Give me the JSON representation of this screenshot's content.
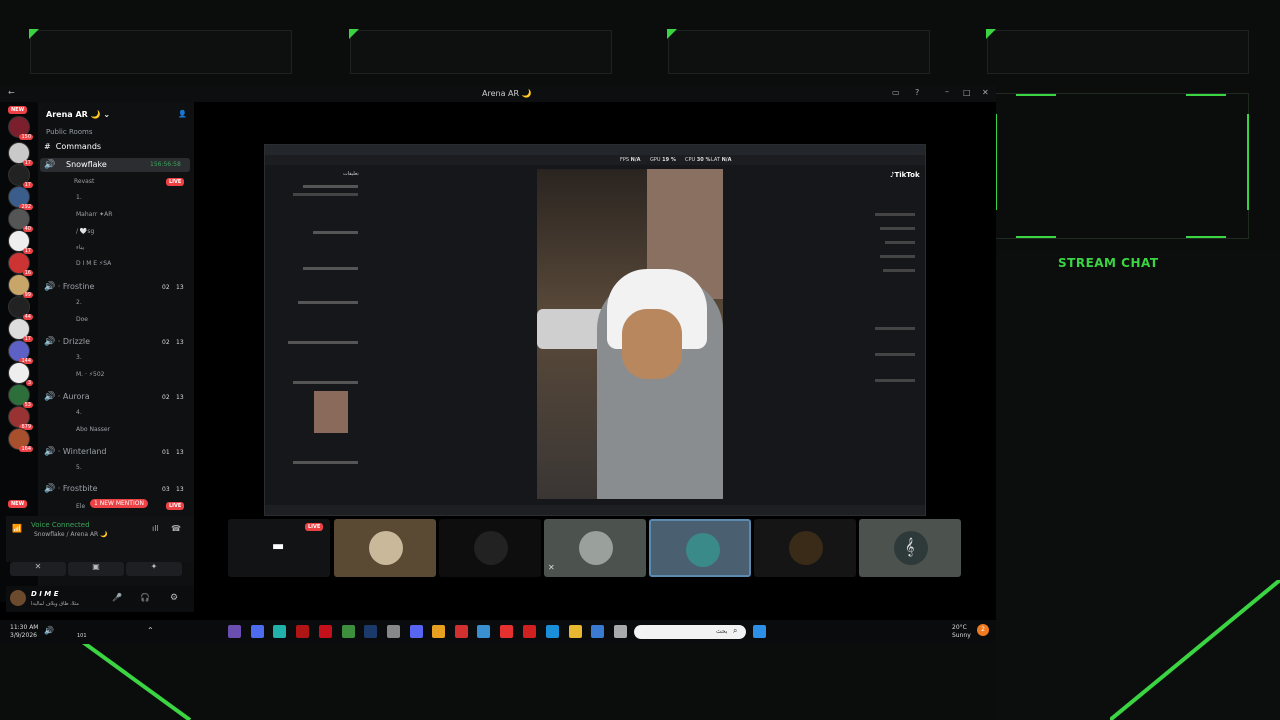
{
  "overlay": {
    "stream_chat_title": "STREAM CHAT"
  },
  "window": {
    "title": "Arena AR 🌙"
  },
  "server_badges": [
    "NEW",
    "150",
    "17",
    "17",
    "292",
    "40",
    "17",
    "16",
    "99",
    "44",
    "17",
    "144",
    "3",
    "53",
    "879",
    "164",
    "NEW"
  ],
  "sidebar": {
    "server_name": "Arena AR 🌙",
    "category": "Public Rooms",
    "commands_channel": "Commands",
    "channels": [
      {
        "name": "Snowflake",
        "timer": "156:56:58"
      },
      {
        "name": "Frostine",
        "counts": [
          "02",
          "13"
        ]
      },
      {
        "name": "Drizzle",
        "counts": [
          "02",
          "13"
        ]
      },
      {
        "name": "Aurora",
        "counts": [
          "02",
          "13"
        ]
      },
      {
        "name": "Winterland",
        "counts": [
          "01",
          "13"
        ]
      },
      {
        "name": "Frostbite",
        "counts": [
          "03",
          "13"
        ]
      }
    ],
    "members": {
      "revast": "Revast",
      "m1": "1.",
      "maharr": "Maharr",
      "maharr_tag": "AR",
      "m_sg": "sg",
      "m_yanaa": "يناء",
      "dime": "D I M E",
      "dime_tag": "SA",
      "m2": "2.",
      "doe": "Doe",
      "m3": "3.",
      "m_m": "M.",
      "m_502": "502",
      "m4": "4.",
      "abo_nasser": "Abo Nasser",
      "m5": "5.",
      "ele": "Ele"
    },
    "live_label": "LIVE",
    "mention_badge": "1 NEW MENTION"
  },
  "voice": {
    "status": "Voice Connected",
    "location": "Snowflake / Arena AR 🌙"
  },
  "user": {
    "name": "D I M E",
    "status_text": "مثلا، طاق ويلاف لماليةا"
  },
  "shared_screen": {
    "fps_label": "FPS",
    "fps_val": "N/A",
    "gpu_label": "GPU",
    "gpu_val": "19 %",
    "cpu_label": "CPU",
    "cpu_val": "30 %",
    "lat_label": "LAT",
    "lat_val": "N/A",
    "brand": "TikTok",
    "comments_header": "تعليقات"
  },
  "tiles": {
    "live_label": "LIVE"
  },
  "taskbar": {
    "time": "11:30 AM",
    "date": "3/9/2026",
    "search_placeholder": "بحث",
    "weather_temp": "20°C",
    "weather_desc": "Sunny",
    "notif_count": "2",
    "vol_val": "101"
  }
}
